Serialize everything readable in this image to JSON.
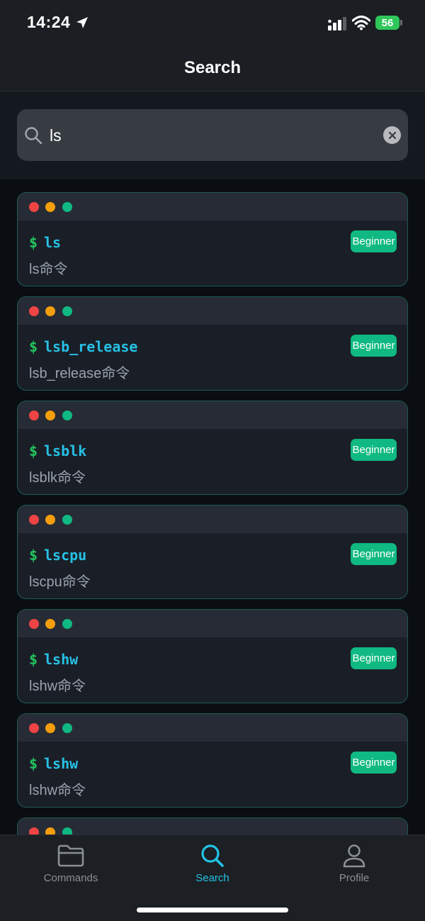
{
  "status_bar": {
    "time": "14:24",
    "battery": "56"
  },
  "nav": {
    "title": "Search"
  },
  "search": {
    "value": "ls",
    "placeholder": ""
  },
  "results": [
    {
      "command": "ls",
      "description": "ls命令",
      "level": "Beginner"
    },
    {
      "command": "lsb_release",
      "description": "lsb_release命令",
      "level": "Beginner"
    },
    {
      "command": "lsblk",
      "description": "lsblk命令",
      "level": "Beginner"
    },
    {
      "command": "lscpu",
      "description": "lscpu命令",
      "level": "Beginner"
    },
    {
      "command": "lshw",
      "description": "lshw命令",
      "level": "Beginner"
    },
    {
      "command": "lshw",
      "description": "lshw命令",
      "level": "Beginner"
    }
  ],
  "prompt_symbol": "$",
  "tabs": [
    {
      "label": "Commands",
      "icon": "folder-icon"
    },
    {
      "label": "Search",
      "icon": "search-icon"
    },
    {
      "label": "Profile",
      "icon": "person-icon"
    }
  ],
  "colors": {
    "accent": "#22c3e6",
    "badge": "#10b981",
    "prompt": "#22c55e",
    "dot_red": "#ef4444",
    "dot_yellow": "#f59e0b",
    "dot_green": "#10b981"
  }
}
